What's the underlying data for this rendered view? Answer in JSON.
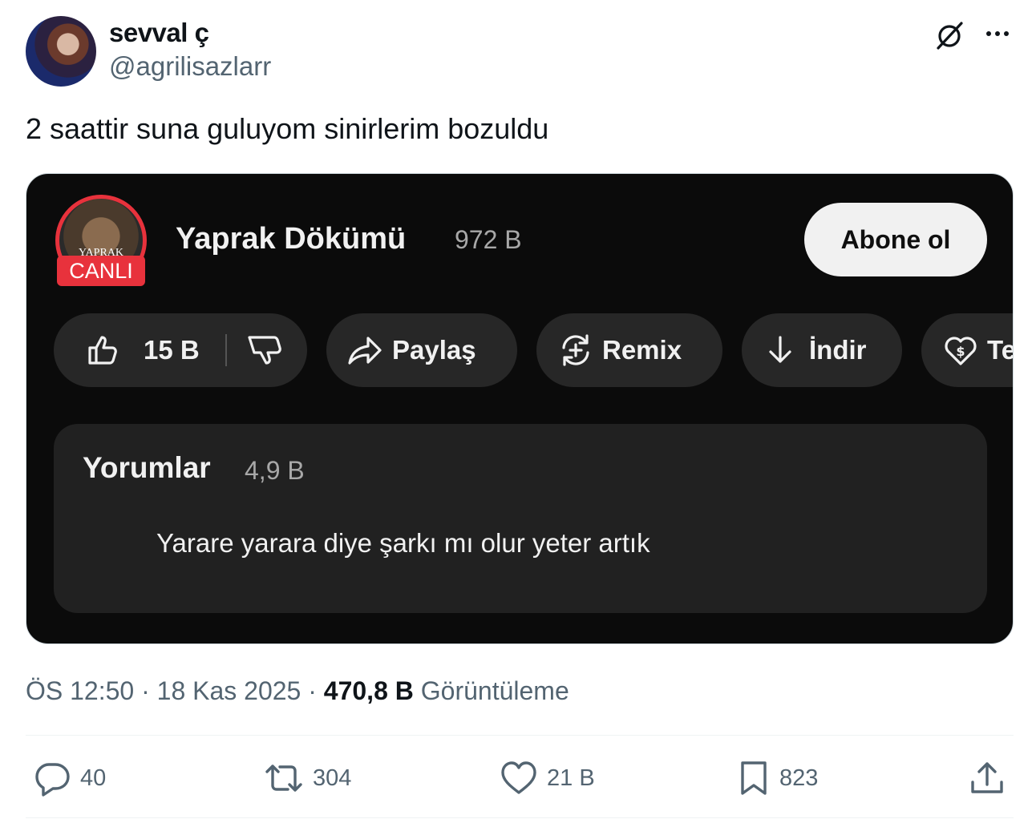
{
  "author": {
    "display_name": "sevval ç",
    "handle": "@agrilisazlarr"
  },
  "tweet": {
    "text": "2 saattir suna guluyom sinirlerim bozuldu"
  },
  "media": {
    "channel": {
      "logo_text": "YAPRAK",
      "live_badge": "CANLI",
      "name": "Yaprak Dökümü",
      "subscribers": "972 B",
      "subscribe_label": "Abone ol"
    },
    "actions": {
      "likes": "15 B",
      "share": "Paylaş",
      "remix": "Remix",
      "download": "İndir",
      "thanks": "Te"
    },
    "comments": {
      "title": "Yorumlar",
      "count": "4,9 B",
      "top_comment": "Yarare yarara diye şarkı mı olur yeter artık"
    },
    "colors": {
      "background": "#0b0b0b",
      "pill": "#272727",
      "live_red": "#e8323c"
    }
  },
  "meta": {
    "time": "ÖS 12:50",
    "date": "18 Kas 2025",
    "views": "470,8 B",
    "views_label": "Görüntüleme"
  },
  "engagement": {
    "replies": "40",
    "reposts": "304",
    "likes": "21 B",
    "bookmarks": "823"
  },
  "icons": [
    "grok-icon",
    "more-icon",
    "thumbs-up-icon",
    "thumbs-down-icon",
    "share-arrow-icon",
    "remix-icon",
    "download-icon",
    "heart-dollar-icon",
    "reply-icon",
    "repost-icon",
    "like-icon",
    "bookmark-icon",
    "share-icon"
  ]
}
